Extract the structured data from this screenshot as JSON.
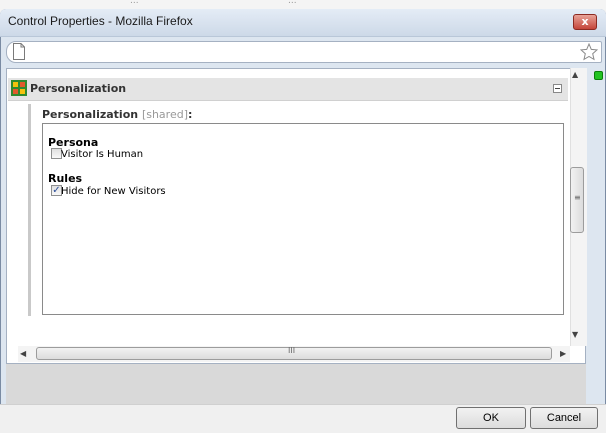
{
  "background": {
    "text1": "...",
    "text2": "..."
  },
  "window": {
    "title": "Control Properties - Mozilla Firefox",
    "close_label": "x"
  },
  "urlbar": {
    "value": ""
  },
  "panel": {
    "title": "Personalization",
    "field_label": "Personalization",
    "field_shared": "[shared]",
    "field_colon": ":",
    "sections": [
      {
        "title": "Persona",
        "item_label": "Visitor Is Human",
        "checked": false
      },
      {
        "title": "Rules",
        "item_label": "Hide for New Visitors",
        "checked": true
      }
    ]
  },
  "scrollbars": {
    "vertical_grip": "≡",
    "horizontal_grip": "III"
  },
  "footer": {
    "ok_label": "OK",
    "cancel_label": "Cancel"
  }
}
